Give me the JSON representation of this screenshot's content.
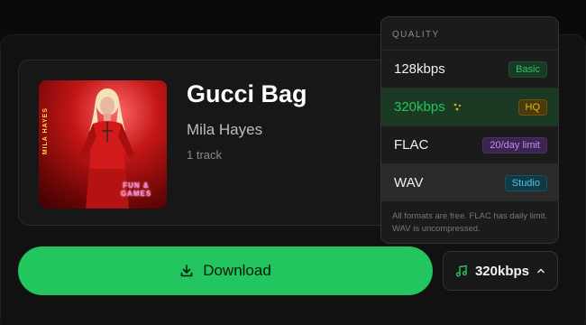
{
  "track": {
    "title": "Gucci Bag",
    "artist": "Mila Hayes",
    "count": "1 track",
    "cover": {
      "artist_text": "MILA HAYES",
      "stamp_text": "FUN & GAMES"
    }
  },
  "actions": {
    "download_label": "Download",
    "quality_selected": "320kbps"
  },
  "quality_menu": {
    "header": "QUALITY",
    "options": [
      {
        "label": "128kbps",
        "badge": "Basic"
      },
      {
        "label": "320kbps",
        "badge": "HQ"
      },
      {
        "label": "FLAC",
        "badge": "20/day limit"
      },
      {
        "label": "WAV",
        "badge": "Studio"
      }
    ],
    "footer": "All formats are free. FLAC has daily limit. WAV is uncompressed."
  },
  "colors": {
    "accent": "#22c55e",
    "background": "#0a0a0a"
  }
}
